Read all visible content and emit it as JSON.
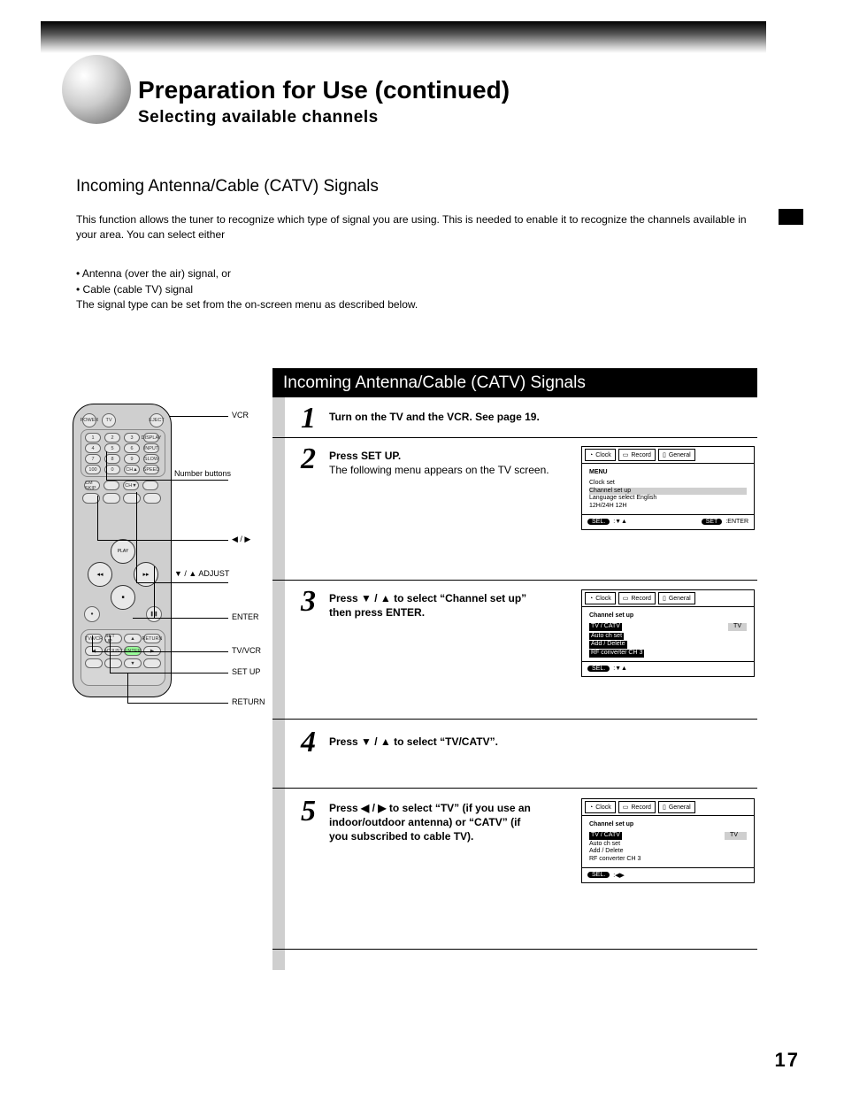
{
  "chapter": {
    "title": "Preparation for Use (continued)",
    "selecting": "Selecting available channels"
  },
  "section_head": "Incoming Antenna/Cable (CATV) Signals",
  "intro": "This function allows the tuner to recognize which type of signal you are using. This is needed to enable it to recognize the channels available in your area. You can select either",
  "bullet1": "• Antenna (over the air) signal, or",
  "bullet2": "• Cable (cable TV) signal",
  "intro2": "The signal type can be set from the on-screen menu as described below.",
  "blackbar": "Incoming Antenna/Cable (CATV) Signals",
  "pagenum": "17",
  "steps": {
    "s1": {
      "num": "1",
      "text": "Turn on the TV and the VCR. See page 19."
    },
    "s2": {
      "num": "2",
      "line1": "Press SET UP.",
      "line2": "The following menu appears on the TV screen."
    },
    "s3": {
      "num": "3",
      "line1": "Press ▼ / ▲ to select “Channel set up”",
      "line2": "then press ENTER."
    },
    "s4": {
      "num": "4",
      "text": "Press ▼ / ▲ to select “TV/CATV”."
    },
    "s5": {
      "num": "5",
      "line1": "Press ◀ / ▶ to select “TV” (if you use an",
      "line2": "indoor/outdoor antenna) or “CATV” (if",
      "line3": "you subscribed to cable TV)."
    }
  },
  "osd_tabs": {
    "clock": "Clock",
    "record": "Record",
    "general": "General"
  },
  "osd2": {
    "title": "MENU",
    "r1": "Clock set",
    "r2": "Channel set up",
    "r3": "Language select          English",
    "r4": "12H/24H                        12H",
    "foot_sel": "SEL.",
    "foot_sel_key": ":▼▲",
    "foot_set": "SET",
    "foot_set_key": ":ENTER"
  },
  "osd3": {
    "title": "Channel set up",
    "r1l": "TV / CATV",
    "r1r": "TV",
    "r2": "Auto ch set",
    "r3": "Add / Delete",
    "r4": "RF converter CH                 3",
    "foot_sel": "SEL.",
    "foot_sel_key": ":▼▲"
  },
  "osd5": {
    "title": "Channel set up",
    "r1l": "TV / CATV",
    "r1r": "TV",
    "r2": "Auto ch set",
    "r3": "Add / Delete",
    "r4": "RF converter CH                 3",
    "foot_sel": "SEL.",
    "foot_sel_key": ":◀▶"
  },
  "remote_labels": {
    "setup": "SET UP",
    "adj": "▼ / ▲  ADJUST",
    "vcr": "VCR",
    "nums": "Number buttons",
    "ent": "ENTER",
    "lr": "◀ / ▶",
    "tvvcr": "TV/VCR",
    "ret": "RETURN"
  },
  "remote_btn": {
    "power": "POWER",
    "tv": "TV",
    "eject": "EJECT",
    "disp": "DISPLAY",
    "input": "INPUT",
    "ssl": "SLOW",
    "spd": "SPEED",
    "play": "PLAY",
    "rew": "REW",
    "ff": "FF",
    "rec": "REC",
    "stop": "STOP",
    "pause": "PAUSE",
    "tvvcr": "TV/VCR",
    "setup": "SET UP",
    "up": "▲",
    "ret": "RETURN",
    "adj": "ADJUST",
    "ent": "ENTER",
    "dn": "▼",
    "cm": "CM SKIP",
    "chup": "CH▲",
    "chdn": "CH▼",
    "z": "0",
    "hund": "100"
  }
}
